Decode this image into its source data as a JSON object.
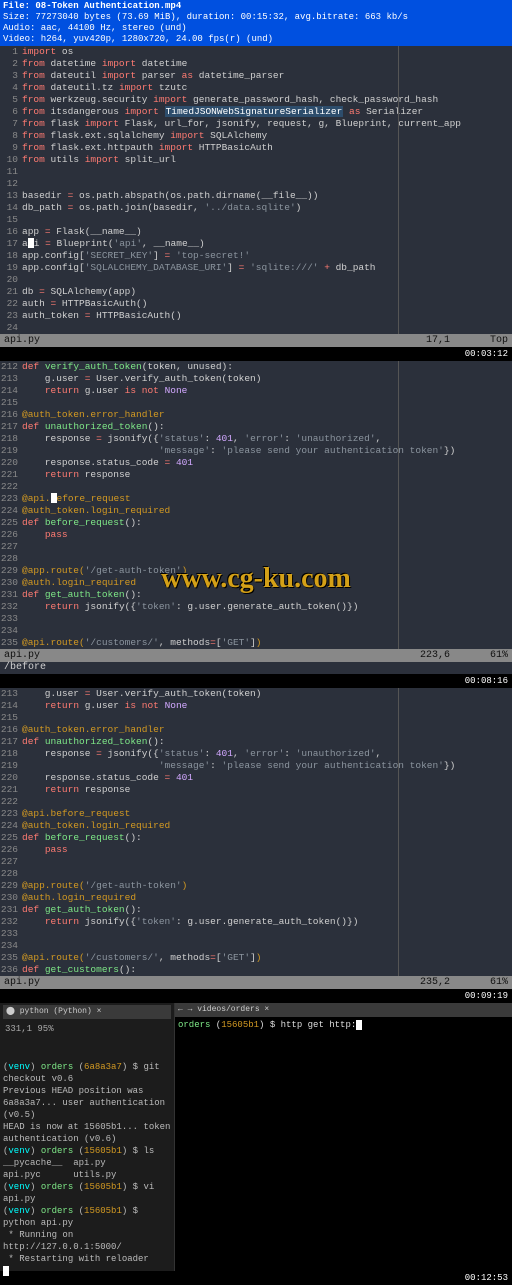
{
  "fileinfo": {
    "l1": "File: 08-Token Authentication.mp4",
    "l2": "Size: 77273040 bytes (73.69 MiB), duration: 00:15:32, avg.bitrate: 663 kb/s",
    "l3": "Audio: aac, 44100 Hz, stereo (und)",
    "l4": "Video: h264, yuv420p, 1280x720, 24.00 fps(r) (und)"
  },
  "pane1": {
    "lines": [
      {
        "n": "1",
        "c": "<span class='kw'>import</span> os"
      },
      {
        "n": "2",
        "c": "<span class='kw'>from</span> datetime <span class='kw'>import</span> datetime"
      },
      {
        "n": "3",
        "c": "<span class='kw'>from</span> dateutil <span class='kw'>import</span> parser <span class='kw'>as</span> datetime_parser"
      },
      {
        "n": "4",
        "c": "<span class='kw'>from</span> dateutil.tz <span class='kw'>import</span> tzutc"
      },
      {
        "n": "5",
        "c": "<span class='kw'>from</span> werkzeug.security <span class='kw'>import</span> generate_password_hash, check_password_hash"
      },
      {
        "n": "6",
        "c": "<span class='kw'>from</span> itsdangerous <span class='kw'>import</span> <span class='hl-box'>TimedJSONWebSignatureSerializer</span> <span class='kw'>as</span> Serializer"
      },
      {
        "n": "7",
        "c": "<span class='kw'>from</span> flask <span class='kw'>import</span> Flask, url_for, jsonify, request, g, Blueprint, current_app"
      },
      {
        "n": "8",
        "c": "<span class='kw'>from</span> flask.ext.sqlalchemy <span class='kw'>import</span> SQLAlchemy"
      },
      {
        "n": "9",
        "c": "<span class='kw'>from</span> flask.ext.httpauth <span class='kw'>import</span> HTTPBasicAuth"
      },
      {
        "n": "10",
        "c": "<span class='kw'>from</span> utils <span class='kw'>import</span> split_url"
      },
      {
        "n": "11",
        "c": ""
      },
      {
        "n": "12",
        "c": ""
      },
      {
        "n": "13",
        "c": "basedir <span class='op'>=</span> os.path.abspath(os.path.dirname(__file__))"
      },
      {
        "n": "14",
        "c": "db_path <span class='op'>=</span> os.path.join(basedir, <span class='str'>'../data.sqlite'</span>)"
      },
      {
        "n": "15",
        "c": ""
      },
      {
        "n": "16",
        "c": "app <span class='op'>=</span> Flask(__name__)"
      },
      {
        "n": "17",
        "c": "a<span class='caret'></span>i <span class='op'>=</span> Blueprint(<span class='str'>'api'</span>, __name__)"
      },
      {
        "n": "18",
        "c": "app.config[<span class='str'>'SECRET_KEY'</span>] <span class='op'>=</span> <span class='str'>'top-secret!'</span>"
      },
      {
        "n": "19",
        "c": "app.config[<span class='str'>'SQLALCHEMY_DATABASE_URI'</span>] <span class='op'>=</span> <span class='str'>'sqlite:///'</span> <span class='op'>+</span> db_path"
      },
      {
        "n": "20",
        "c": ""
      },
      {
        "n": "21",
        "c": "db <span class='op'>=</span> SQLAlchemy(app)"
      },
      {
        "n": "22",
        "c": "auth <span class='op'>=</span> HTTPBasicAuth()"
      },
      {
        "n": "23",
        "c": "auth_token <span class='op'>=</span> HTTPBasicAuth()"
      },
      {
        "n": "24",
        "c": ""
      }
    ],
    "status": {
      "file": "api.py",
      "pos": "17,1",
      "pct": "Top"
    },
    "ts": "00:03:12"
  },
  "pane2": {
    "lines": [
      {
        "n": "212",
        "c": "<span class='kw'>def</span> <span class='fn'>verify_auth_token</span>(token, unused):"
      },
      {
        "n": "213",
        "c": "    g.user <span class='op'>=</span> User.verify_auth_token(token)"
      },
      {
        "n": "214",
        "c": "    <span class='kw'>return</span> g.user <span class='kw'>is not</span> <span class='num'>None</span>"
      },
      {
        "n": "215",
        "c": ""
      },
      {
        "n": "216",
        "c": "<span class='dec'>@auth_token.error_handler</span>"
      },
      {
        "n": "217",
        "c": "<span class='kw'>def</span> <span class='fn'>unauthorized_token</span>():"
      },
      {
        "n": "218",
        "c": "    response <span class='op'>=</span> jsonify({<span class='str'>'status'</span>: <span class='num'>401</span>, <span class='str'>'error'</span>: <span class='str'>'unauthorized'</span>,"
      },
      {
        "n": "219",
        "c": "                        <span class='str'>'message'</span>: <span class='str'>'please send your authentication token'</span>})"
      },
      {
        "n": "220",
        "c": "    response.status_code <span class='op'>=</span> <span class='num'>401</span>"
      },
      {
        "n": "221",
        "c": "    <span class='kw'>return</span> response"
      },
      {
        "n": "222",
        "c": ""
      },
      {
        "n": "223",
        "c": "<span class='dec'>@api.<span class='caret'></span>efore_request</span>"
      },
      {
        "n": "224",
        "c": "<span class='dec'>@auth_token.login_required</span>"
      },
      {
        "n": "225",
        "c": "<span class='kw'>def</span> <span class='fn'>before_request</span>():"
      },
      {
        "n": "226",
        "c": "    <span class='kw'>pass</span>"
      },
      {
        "n": "227",
        "c": ""
      },
      {
        "n": "228",
        "c": ""
      },
      {
        "n": "229",
        "c": "<span class='dec'>@app.route(</span><span class='str'>'/get-auth-token'</span><span class='dec'>)</span>"
      },
      {
        "n": "230",
        "c": "<span class='dec'>@auth.login_required</span>"
      },
      {
        "n": "231",
        "c": "<span class='kw'>def</span> <span class='fn'>get_auth_token</span>():"
      },
      {
        "n": "232",
        "c": "    <span class='kw'>return</span> jsonify({<span class='str'>'token'</span>: g.user.generate_auth_token()})"
      },
      {
        "n": "233",
        "c": ""
      },
      {
        "n": "234",
        "c": ""
      },
      {
        "n": "235",
        "c": "<span class='dec'>@api.route(</span><span class='str'>'/customers/'</span>, methods<span class='op'>=</span>[<span class='str'>'GET'</span>]<span class='dec'>)</span>"
      }
    ],
    "status": {
      "file": "api.py",
      "pos": "223,6",
      "pct": "61%"
    },
    "status2": "/before",
    "ts": "00:08:16"
  },
  "pane3": {
    "lines": [
      {
        "n": "213",
        "c": "    g.user <span class='op'>=</span> User.verify_auth_token(token)"
      },
      {
        "n": "214",
        "c": "    <span class='kw'>return</span> g.user <span class='kw'>is not</span> <span class='num'>None</span>"
      },
      {
        "n": "215",
        "c": ""
      },
      {
        "n": "216",
        "c": "<span class='dec'>@auth_token.error_handler</span>"
      },
      {
        "n": "217",
        "c": "<span class='kw'>def</span> <span class='fn'>unauthorized_token</span>():"
      },
      {
        "n": "218",
        "c": "    response <span class='op'>=</span> jsonify({<span class='str'>'status'</span>: <span class='num'>401</span>, <span class='str'>'error'</span>: <span class='str'>'unauthorized'</span>,"
      },
      {
        "n": "219",
        "c": "                        <span class='str'>'message'</span>: <span class='str'>'please send your authentication token'</span>})"
      },
      {
        "n": "220",
        "c": "    response.status_code <span class='op'>=</span> <span class='num'>401</span>"
      },
      {
        "n": "221",
        "c": "    <span class='kw'>return</span> response"
      },
      {
        "n": "222",
        "c": ""
      },
      {
        "n": "223",
        "c": "<span class='dec'>@api.before_request</span>"
      },
      {
        "n": "224",
        "c": "<span class='dec'>@auth_token.login_required</span>"
      },
      {
        "n": "225",
        "c": "<span class='kw'>def</span> <span class='fn'>before_request</span>():"
      },
      {
        "n": "226",
        "c": "    <span class='kw'>pass</span>"
      },
      {
        "n": "227",
        "c": ""
      },
      {
        "n": "228",
        "c": ""
      },
      {
        "n": "229",
        "c": "<span class='dec'>@app.route(</span><span class='str'>'/get-auth-token'</span><span class='dec'>)</span>"
      },
      {
        "n": "230",
        "c": "<span class='dec'>@auth.login_required</span>"
      },
      {
        "n": "231",
        "c": "<span class='kw'>def</span> <span class='fn'>get_auth_token</span>():"
      },
      {
        "n": "232",
        "c": "    <span class='kw'>return</span> jsonify({<span class='str'>'token'</span>: g.user.generate_auth_token()})"
      },
      {
        "n": "233",
        "c": ""
      },
      {
        "n": "234",
        "c": ""
      },
      {
        "n": "235",
        "c": "<span class='dec'>@api.route(</span><span class='str'>'/customers/'</span>, methods<span class='op'>=</span>[<span class='str'>'GET'</span>]<span class='dec'>)</span>"
      },
      {
        "n": "236",
        "c": "<span class='kw'>def</span> <span class='fn'>get_customers</span>():"
      }
    ],
    "status": {
      "file": "api.py",
      "pos": "235,2",
      "pct": "61%"
    },
    "ts": "00:09:19"
  },
  "term": {
    "left_tab": "⬤ python (Python)                 ×",
    "right_tab": "← →  videos/orders                 ×",
    "left_counter": "331,1          95%",
    "left_lines": [
      "",
      "",
      "(<span class='prompt-venv'>venv</span>) <span class='prompt-dir'>orders</span> (<span class='prompt-hash'>6a8a3a7</span>) $ git checkout v0.6",
      "Previous HEAD position was 6a8a3a7... user authentication (v0.5)",
      "HEAD is now at 15605b1... token authentication (v0.6)",
      "(<span class='prompt-venv'>venv</span>) <span class='prompt-dir'>orders</span> (<span class='prompt-hash'>15605b1</span>) $ ls",
      "__pycache__  api.py       api.pyc      utils.py",
      "(<span class='prompt-venv'>venv</span>) <span class='prompt-dir'>orders</span> (<span class='prompt-hash'>15605b1</span>) $ vi api.py",
      "(<span class='prompt-venv'>venv</span>) <span class='prompt-dir'>orders</span> (<span class='prompt-hash'>15605b1</span>) $ python api.py",
      " * Running on http://127.0.0.1:5000/",
      " * Restarting with reloader",
      "<span class='caret'></span>"
    ],
    "right_line": "<span class='prompt-dir'>orders</span> (<span class='prompt-hash'>15605b1</span>) $ http get http:<span class='caret'></span>",
    "ts": "00:12:53"
  },
  "watermark": "www.cg-ku.com"
}
